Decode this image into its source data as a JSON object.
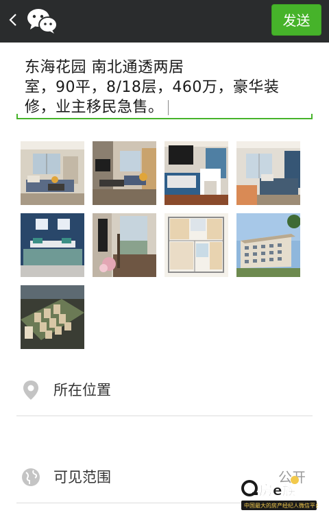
{
  "header": {
    "back_icon": "chevron-left-icon",
    "app_icon": "wechat-icon",
    "send_label": "发送",
    "accent": "#46b32a",
    "bg": "#2a2c2d"
  },
  "composer": {
    "text": "东海花园 南北通透两居\n室，90平，8/18层，460万，豪华装\n修，业主移民急售。"
  },
  "photos": [
    {
      "alt": "living-room-photo-1"
    },
    {
      "alt": "living-room-photo-2"
    },
    {
      "alt": "study-room-photo"
    },
    {
      "alt": "bedroom-photo-1"
    },
    {
      "alt": "bedroom-photo-2"
    },
    {
      "alt": "balcony-photo"
    },
    {
      "alt": "floor-plan-photo"
    },
    {
      "alt": "building-exterior-photo"
    },
    {
      "alt": "community-aerial-photo"
    }
  ],
  "options": {
    "location": {
      "label": "所在位置",
      "icon": "location-pin-icon"
    },
    "visibility": {
      "label": "可见范围",
      "icon": "globe-icon",
      "value": "公开"
    }
  },
  "watermark": {
    "brand": "房e族",
    "tagline": "中国最大的房产经纪人微信平台"
  }
}
